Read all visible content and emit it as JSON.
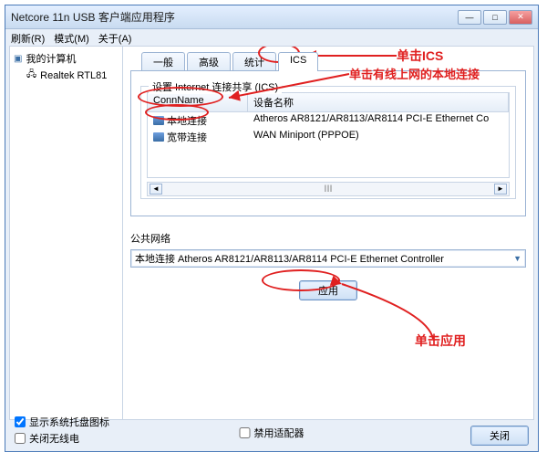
{
  "window": {
    "title": "Netcore 11n USB 客户端应用程序"
  },
  "menu": {
    "refresh": "刷新(R)",
    "mode": "模式(M)",
    "about": "关于(A)"
  },
  "tree": {
    "root": "我的计算机",
    "adapter": "Realtek RTL81"
  },
  "tabs": {
    "general": "一般",
    "advanced": "高级",
    "stats": "统计",
    "ics": "ICS"
  },
  "ics": {
    "group_label": "设置 Internet 连接共享 (ICS)",
    "col_conn": "ConnName",
    "col_dev": "设备名称",
    "rows": [
      {
        "name": "本地连接",
        "device": "Atheros AR8121/AR8113/AR8114 PCI-E Ethernet Co"
      },
      {
        "name": "宽带连接",
        "device": "WAN Miniport (PPPOE)"
      }
    ],
    "scroll_mid": "III"
  },
  "public_net": {
    "label": "公共网络",
    "value": "本地连接 Atheros AR8121/AR8113/AR8114 PCI-E Ethernet Controller"
  },
  "buttons": {
    "apply": "应用",
    "close": "关闭"
  },
  "checks": {
    "tray": "显示系统托盘图标",
    "wifi_off": "关闭无线电",
    "disable_adapter": "禁用适配器"
  },
  "annotations": {
    "click_ics": "单击ICS",
    "click_local": "单击有线上网的本地连接",
    "click_apply": "单击应用"
  },
  "win_controls": {
    "min": "—",
    "max": "□",
    "close": "✕"
  }
}
